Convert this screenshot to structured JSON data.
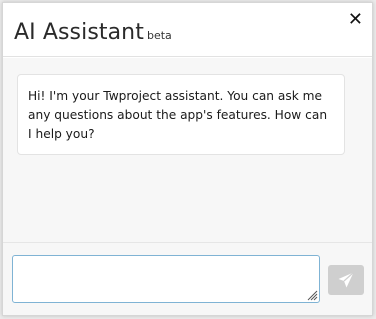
{
  "dialog": {
    "title": "AI Assistant",
    "badge": "beta",
    "close_label": "✕"
  },
  "messages": [
    {
      "role": "assistant",
      "text": "Hi! I'm your Twproject assistant. You can ask me any questions about the app's features. How can I help you?"
    }
  ],
  "composer": {
    "input_value": "",
    "send_icon": "paper-plane-icon",
    "send_button_color": "#cfcfcf"
  },
  "colors": {
    "input_border": "#7fb3d4",
    "chat_background": "#f7f7f7"
  }
}
